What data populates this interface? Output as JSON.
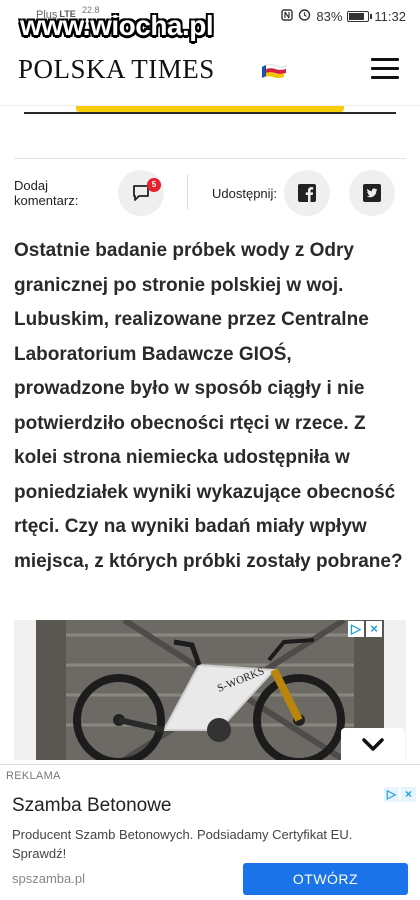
{
  "status_bar": {
    "carrier": "Plus",
    "network": "LTE",
    "speed": "22.8",
    "battery": "83%",
    "battery_level": 0.83,
    "time": "11:32",
    "icons": [
      "nfc-icon",
      "alarm-icon",
      "battery-icon"
    ]
  },
  "watermark": "www.wiocha.pl",
  "header": {
    "brand": "POLSKA TIMES",
    "flag_colors": [
      "#ffffff",
      "#d4213d",
      "#f6c300",
      "#1d4fa6"
    ],
    "menu_icon": "hamburger-icon"
  },
  "share": {
    "comment_label": "Dodaj komentarz:",
    "comment_count": "5",
    "share_label": "Udostępnij:",
    "facebook_icon": "facebook-icon",
    "twitter_icon": "twitter-icon"
  },
  "article": {
    "text": "Ostatnie badanie próbek wody z Odry granicznej po stronie polskiej w woj. Lubuskim, realizowane przez Centralne Laboratorium Badawcze GIOŚ, prowadzone było w sposób ciągły i nie potwierdziło obecności rtęci w rzece. Z kolei strona niemiecka udostępniła w poniedziałek wyniki wykazujące obecność rtęci. Czy na wyniki badań miały wpływ miejsca, z których próbki zostały pobrane?"
  },
  "ad_image": {
    "brand_text": "S-WORKS",
    "choices_icons": [
      "adchoices-icon",
      "close-icon"
    ],
    "expand_icon": "chevron-down-icon"
  },
  "sticky_ad": {
    "label": "REKLAMA",
    "title": "Szamba Betonowe",
    "description": "Producent Szamb Betonowych. Podsiadamy Certyfikat EU. Sprawdź!",
    "domain": "spszamba.pl",
    "cta": "OTWÓRZ",
    "accent": "#1a73e8"
  }
}
